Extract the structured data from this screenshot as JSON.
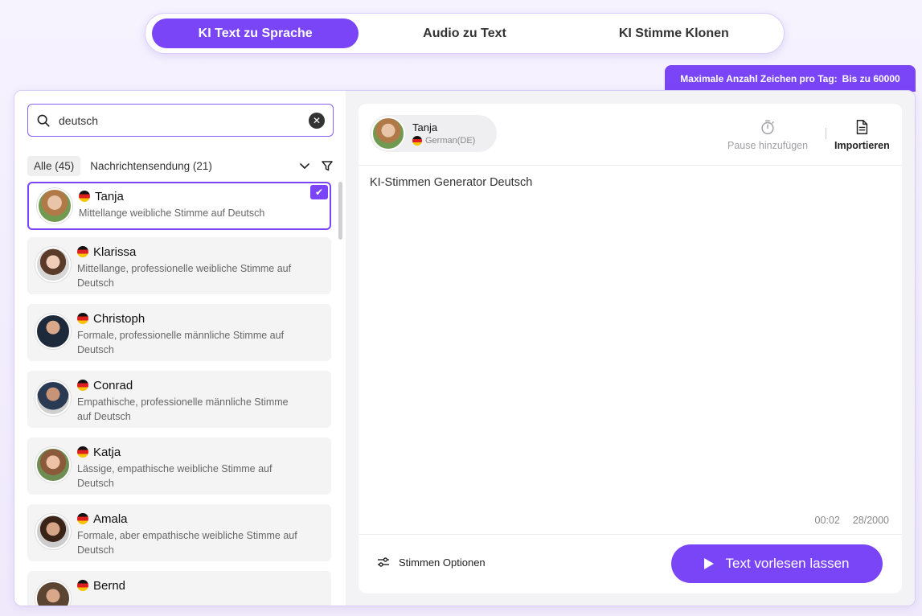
{
  "tabs": [
    {
      "label": "KI Text zu Sprache",
      "active": true
    },
    {
      "label": "Audio zu Text",
      "active": false
    },
    {
      "label": "KI Stimme Klonen",
      "active": false
    }
  ],
  "limit": {
    "label": "Maximale Anzahl Zeichen pro Tag:",
    "value": "Bis zu 60000"
  },
  "search": {
    "value": "deutsch",
    "icon": "search-icon"
  },
  "filters": {
    "all": "Alle (45)",
    "news": "Nachrichtensendung (21)"
  },
  "voices": [
    {
      "name": "Tanja",
      "desc": "Mittellange weibliche Stimme auf Deutsch",
      "selected": true
    },
    {
      "name": "Klarissa",
      "desc": "Mittellange, professionelle weibliche Stimme auf Deutsch"
    },
    {
      "name": "Christoph",
      "desc": "Formale, professionelle männliche Stimme auf Deutsch"
    },
    {
      "name": "Conrad",
      "desc": "Empathische, professionelle männliche Stimme auf Deutsch"
    },
    {
      "name": "Katja",
      "desc": "Lässige, empathische weibliche Stimme auf Deutsch"
    },
    {
      "name": "Amala",
      "desc": "Formale, aber empathische weibliche Stimme auf Deutsch"
    },
    {
      "name": "Bernd",
      "desc": ""
    }
  ],
  "current_voice": {
    "name": "Tanja",
    "lang": "German(DE)"
  },
  "toolbar": {
    "pause": "Pause hinzufügen",
    "import": "Importieren"
  },
  "editor": {
    "text": "KI-Stimmen Generator Deutsch",
    "duration": "00:02",
    "count": "28/2000"
  },
  "footer": {
    "options": "Stimmen Optionen",
    "play": "Text vorlesen lassen"
  },
  "colors": {
    "accent": "#7a45f6"
  }
}
